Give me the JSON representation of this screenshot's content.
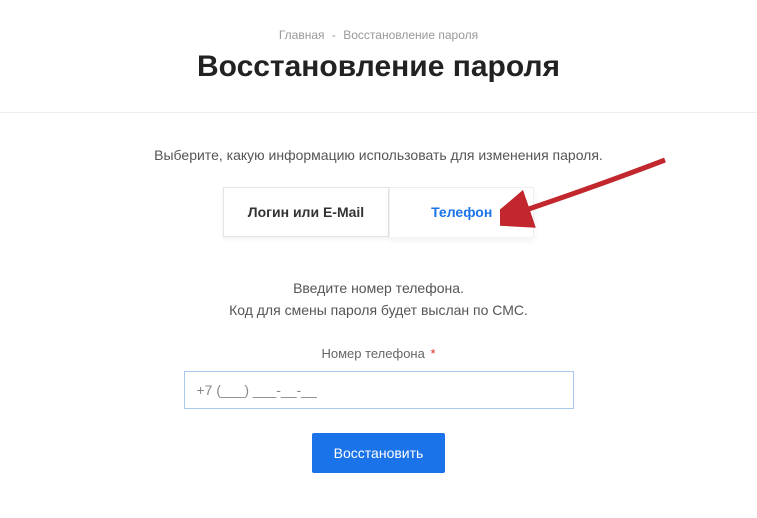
{
  "breadcrumb": {
    "home": "Главная",
    "separator": "-",
    "current": "Восстановление пароля"
  },
  "page_title": "Восстановление пароля",
  "instruction": "Выберите, какую информацию использовать для изменения пароля.",
  "tabs": {
    "login_email": "Логин или E-Mail",
    "phone": "Телефон"
  },
  "phone_section": {
    "line1": "Введите номер телефона.",
    "line2": "Код для смены пароля будет выслан по СМС."
  },
  "field": {
    "label": "Номер телефона",
    "required_mark": "*",
    "value": "+7 (___) ___-__-__"
  },
  "submit_label": "Восстановить",
  "colors": {
    "accent": "#1a73e8",
    "required": "#d93025",
    "arrow": "#c1272d"
  }
}
